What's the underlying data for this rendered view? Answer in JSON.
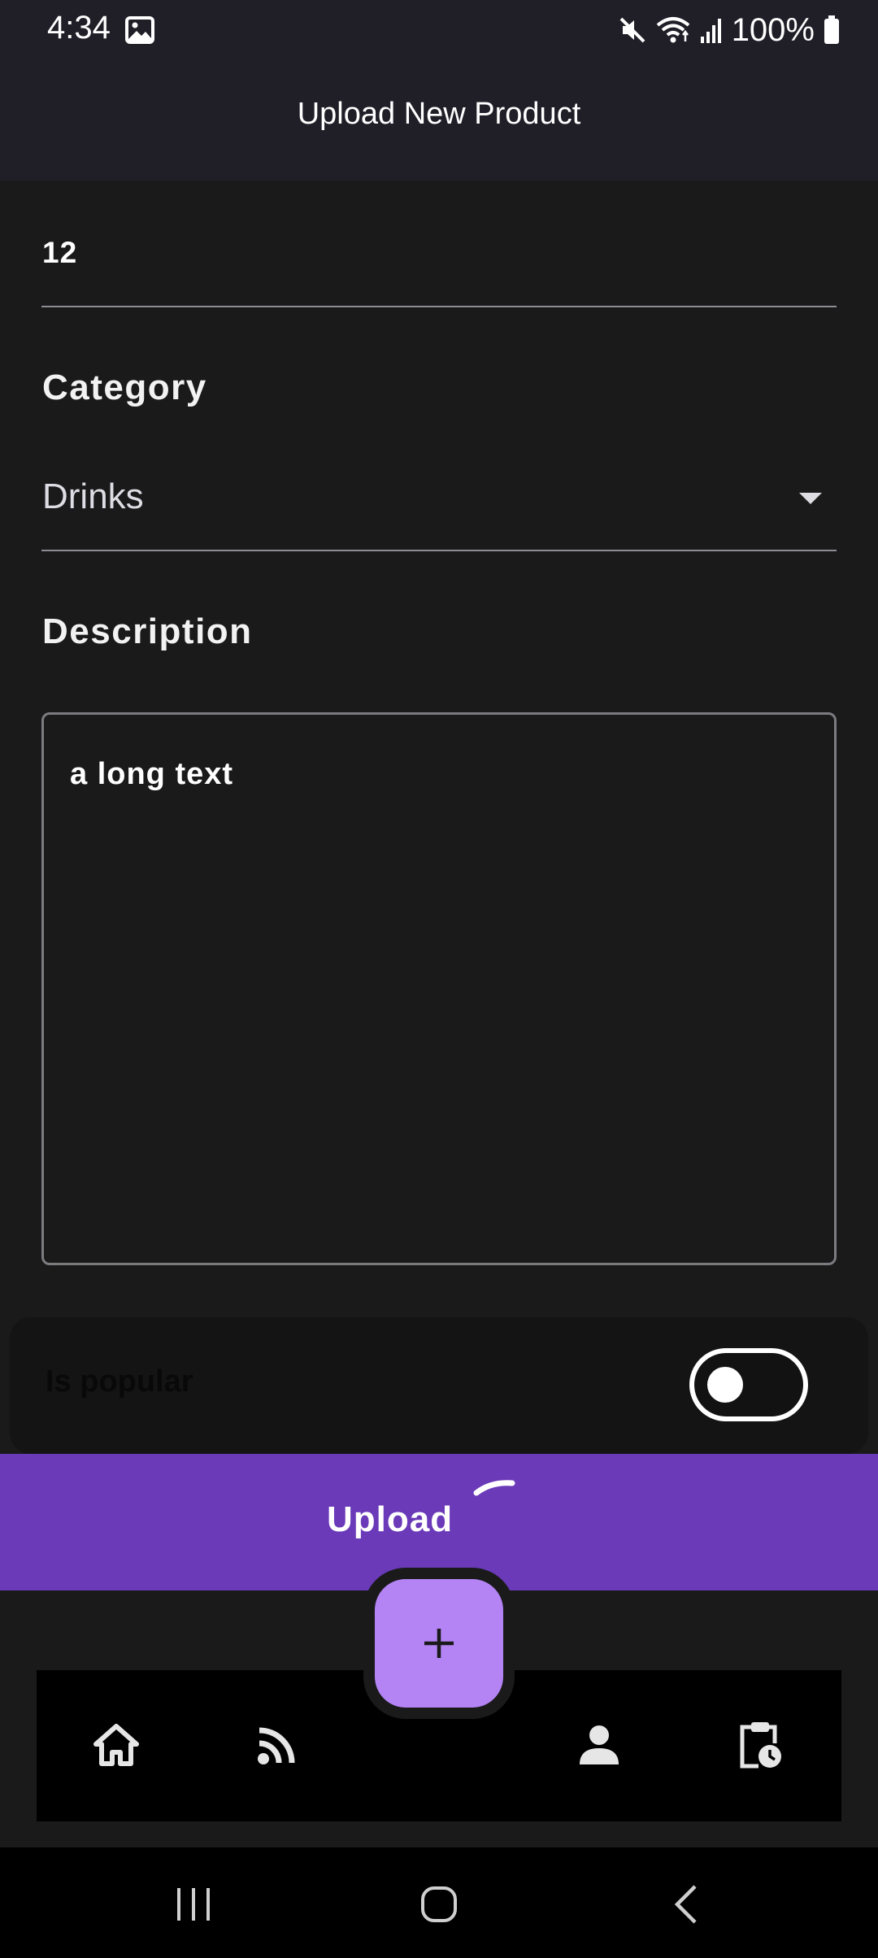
{
  "status_bar": {
    "time": "4:34",
    "battery": "100%",
    "icons": [
      "gallery-icon",
      "mute-icon",
      "wifi-icon",
      "signal-icon",
      "battery-icon"
    ]
  },
  "app_bar": {
    "title": "Upload New Product"
  },
  "form": {
    "price_value": "12",
    "category_label": "Category",
    "category_value": "Drinks",
    "description_label": "Description",
    "description_value": "a long text",
    "popular_label": "Is popular",
    "popular_on": false
  },
  "upload_button": {
    "label": "Upload",
    "loading": true
  },
  "bottom_nav": {
    "items": [
      "home-icon",
      "feed-icon",
      "profile-icon",
      "orders-history-icon"
    ],
    "fab_icon": "plus-icon"
  },
  "system_nav": {
    "items": [
      "recents-icon",
      "home-circle-icon",
      "back-icon"
    ]
  },
  "colors": {
    "app_bar": "#201f28",
    "background": "#1a1a1b",
    "upload_button": "#6a3ab8",
    "fab": "#b484f5"
  }
}
